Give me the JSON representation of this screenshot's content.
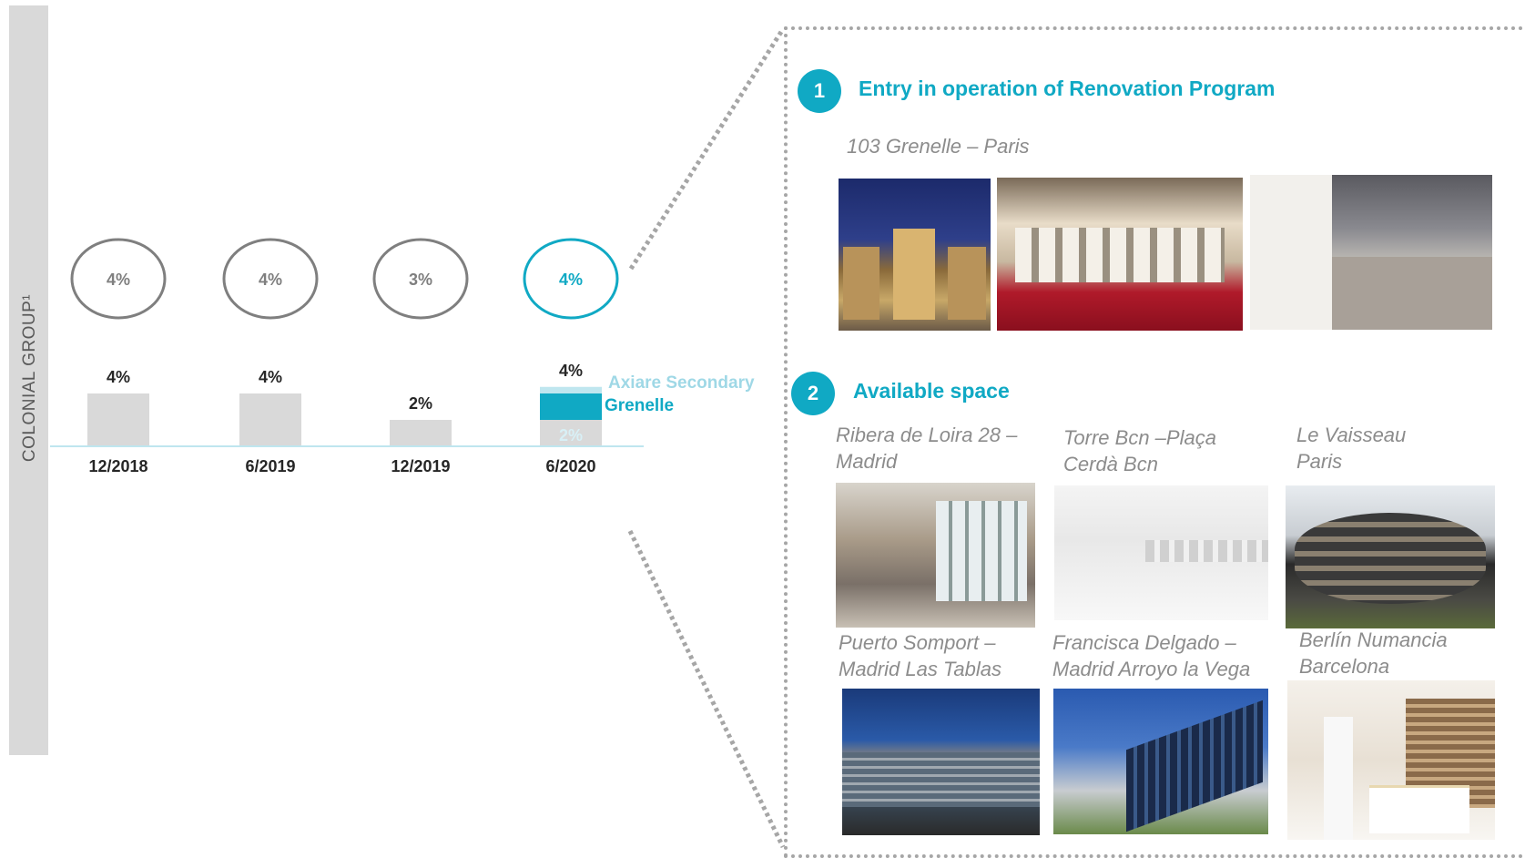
{
  "side_label": "COLONIAL  GROUP¹",
  "rings": [
    {
      "label": "4%",
      "highlight": false
    },
    {
      "label": "4%",
      "highlight": false
    },
    {
      "label": "3%",
      "highlight": false
    },
    {
      "label": "4%",
      "highlight": true
    }
  ],
  "chart_data": {
    "type": "bar",
    "categories": [
      "12/2018",
      "6/2019",
      "12/2019",
      "6/2020"
    ],
    "series": [
      {
        "name": "",
        "values": [
          4,
          4,
          2,
          2
        ],
        "color": "#d9d9d9"
      },
      {
        "name": "Grenelle",
        "values": [
          0,
          0,
          0,
          2
        ],
        "color": "#10a9c4"
      },
      {
        "name": "Axiare Secondary",
        "values": [
          0,
          0,
          0,
          0.5
        ],
        "color": "#bfe6ef"
      }
    ],
    "top_labels": [
      "4%",
      "4%",
      "2%",
      "4%"
    ],
    "inner_labels": [
      "",
      "",
      "",
      "2%"
    ],
    "ylim": [
      0,
      5
    ],
    "grid": false
  },
  "legend": {
    "axiare": "Axiare Secondary",
    "grenelle": "Grenelle"
  },
  "colors": {
    "accent": "#10a9c4",
    "ring_gray": "#7f7f7f",
    "bar_gray": "#d9d9d9",
    "light_accent": "#bfe6ef"
  },
  "section1": {
    "number": "1",
    "title": "Entry in operation of Renovation Program",
    "caption": "103 Grenelle – Paris"
  },
  "section2": {
    "number": "2",
    "title": "Available space",
    "captions": [
      {
        "line1": "Ribera de Loira 28 –",
        "line2": "Madrid"
      },
      {
        "line1": "Torre Bcn –Plaça",
        "line2": "Cerdà Bcn"
      },
      {
        "line1": "Le Vaisseau",
        "line2": "Paris"
      },
      {
        "line1": "Puerto Somport –",
        "line2": "Madrid Las Tablas"
      },
      {
        "line1": "Francisca Delgado –",
        "line2": "Madrid Arroyo la Vega"
      },
      {
        "line1": "Berlín Numancia",
        "line2": "Barcelona"
      }
    ]
  }
}
